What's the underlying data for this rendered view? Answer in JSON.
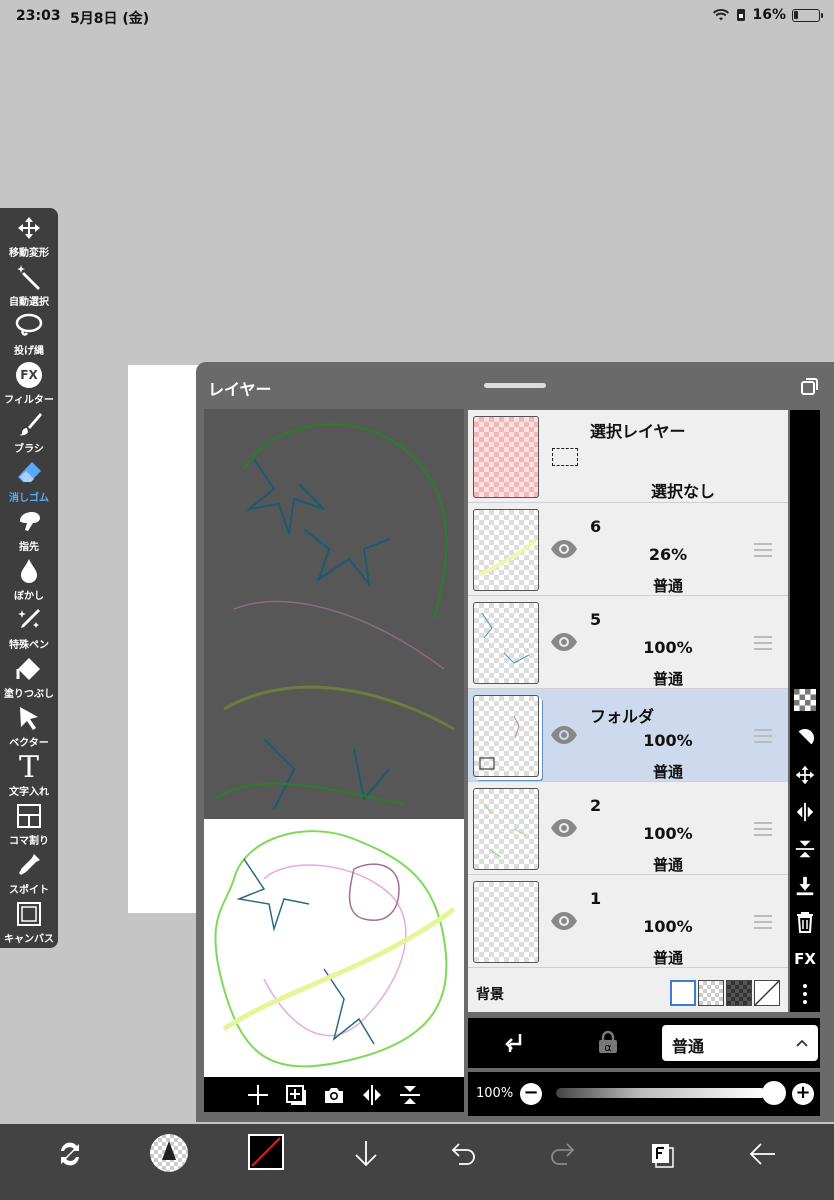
{
  "status": {
    "time": "23:03",
    "date": "5月8日 (金)",
    "battery": "16%"
  },
  "tools": [
    {
      "label": "移動変形",
      "icon": "move-icon"
    },
    {
      "label": "自動選択",
      "icon": "magic-wand-icon"
    },
    {
      "label": "投げ縄",
      "icon": "lasso-icon"
    },
    {
      "label": "フィルター",
      "icon": "fx-icon"
    },
    {
      "label": "ブラシ",
      "icon": "brush-icon"
    },
    {
      "label": "消しゴム",
      "icon": "eraser-icon",
      "active": true
    },
    {
      "label": "指先",
      "icon": "finger-icon"
    },
    {
      "label": "ぼかし",
      "icon": "blur-drop-icon"
    },
    {
      "label": "特殊ペン",
      "icon": "special-pen-icon"
    },
    {
      "label": "塗りつぶし",
      "icon": "fill-bucket-icon"
    },
    {
      "label": "ベクター",
      "icon": "vector-cursor-icon"
    },
    {
      "label": "文字入れ",
      "icon": "text-icon"
    },
    {
      "label": "コマ割り",
      "icon": "frame-divide-icon"
    },
    {
      "label": "スポイト",
      "icon": "eyedropper-icon"
    },
    {
      "label": "キャンバス",
      "icon": "canvas-icon"
    }
  ],
  "fx_glyph": "FX",
  "text_glyph": "T",
  "layer_panel": {
    "title": "レイヤー",
    "selection_layer": {
      "name": "選択レイヤー",
      "status": "選択なし"
    },
    "layers": [
      {
        "name": "6",
        "opacity": "26%",
        "blend": "普通"
      },
      {
        "name": "5",
        "opacity": "100%",
        "blend": "普通"
      },
      {
        "name": "フォルダ",
        "opacity": "100%",
        "blend": "普通",
        "selected": true
      },
      {
        "name": "2",
        "opacity": "100%",
        "blend": "普通"
      },
      {
        "name": "1",
        "opacity": "100%",
        "blend": "普通"
      }
    ],
    "background_label": "背景",
    "blend_mode": "普通",
    "opacity_label": "100%",
    "opacity_value": 1.0,
    "minus_label": "−",
    "plus_label": "+",
    "fx_label": "FX"
  },
  "colors": {
    "accent": "#5aa9ff",
    "selected_row": "#cdd9ec"
  }
}
